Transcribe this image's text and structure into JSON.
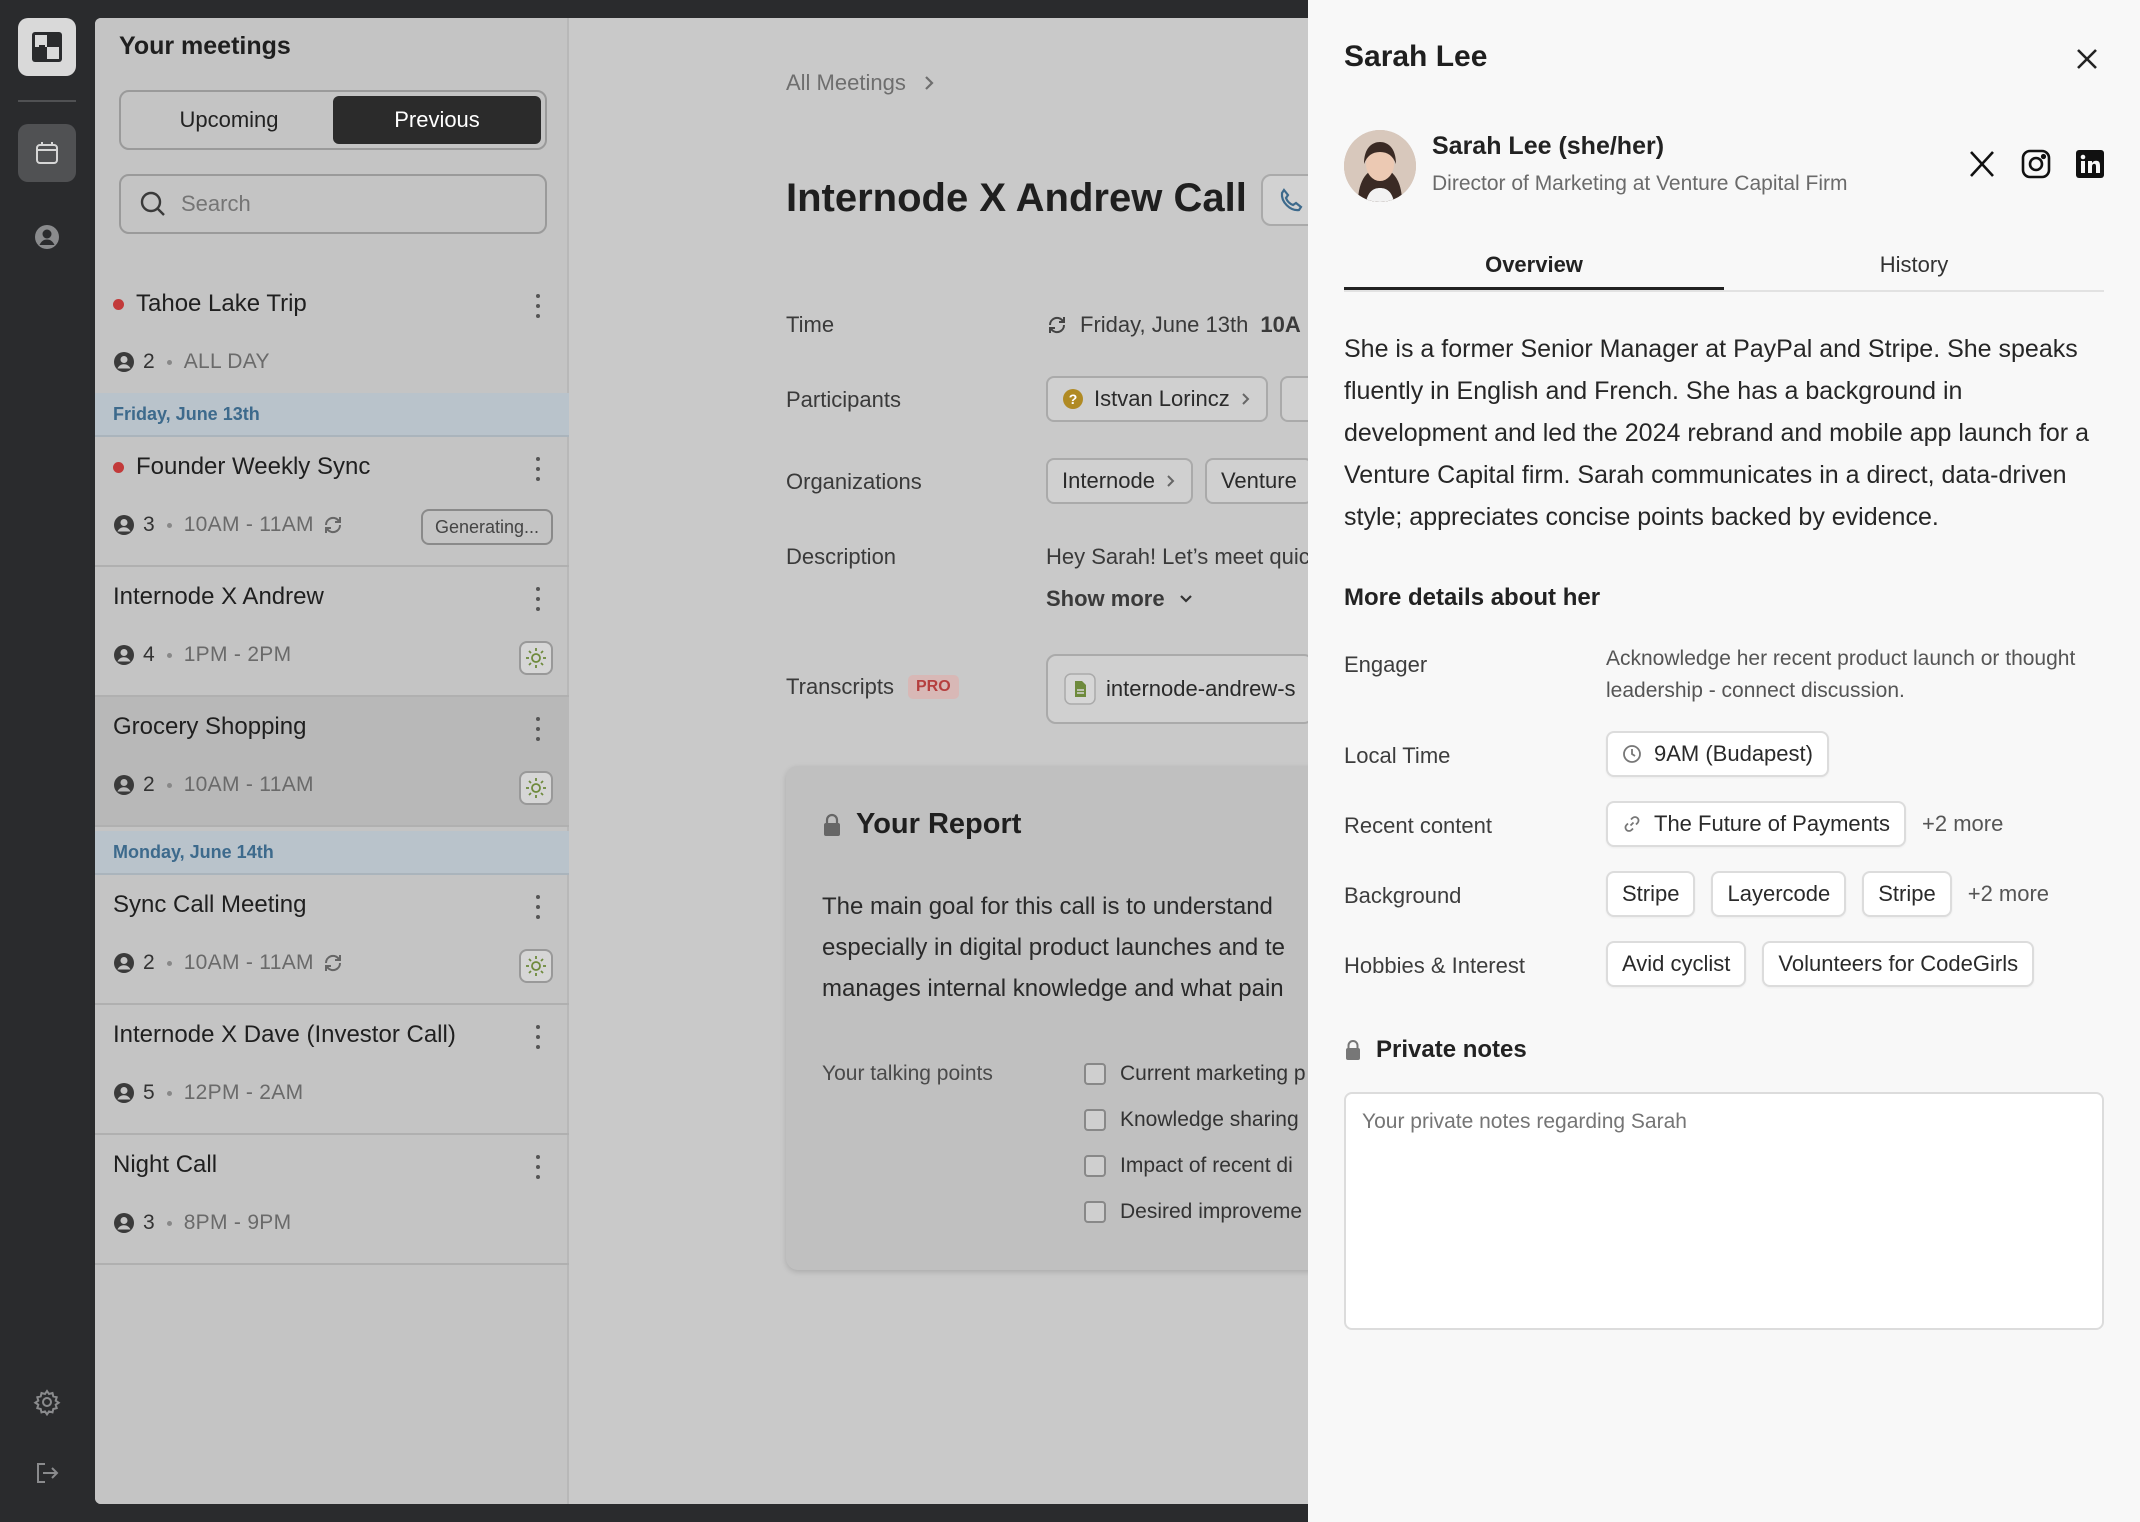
{
  "sidebar_title": "Your meetings",
  "segment": {
    "upcoming": "Upcoming",
    "previous": "Previous"
  },
  "search": {
    "placeholder": "Search"
  },
  "meetings": [
    {
      "title": "Tahoe Lake Trip",
      "count": "2",
      "time": "ALL DAY"
    },
    {
      "title": "Founder Weekly Sync",
      "count": "3",
      "time": "10AM - 11AM",
      "status": "Generating..."
    },
    {
      "title": "Internode X Andrew",
      "count": "4",
      "time": "1PM - 2PM"
    },
    {
      "title": "Grocery Shopping",
      "count": "2",
      "time": "10AM - 11AM"
    },
    {
      "title": "Sync Call Meeting",
      "count": "2",
      "time": "10AM - 11AM"
    },
    {
      "title": "Internode X Dave (Investor Call)",
      "count": "5",
      "time": "12PM - 2AM"
    },
    {
      "title": "Night Call",
      "count": "3",
      "time": "8PM - 9PM"
    }
  ],
  "day_headers": [
    "Friday, June 13th",
    "Monday, June 14th"
  ],
  "detail": {
    "breadcrumb": "All Meetings",
    "title": "Internode X Andrew Call",
    "time_label": "Time",
    "time_value": "Friday, June 13th",
    "time_bold": "10A",
    "participants_label": "Participants",
    "participant": "Istvan Lorincz",
    "organizations_label": "Organizations",
    "org1": "Internode",
    "org2": "Venture",
    "description_label": "Description",
    "description": "Hey Sarah! Let’s meet quic",
    "show_more": "Show more",
    "transcripts_label": "Transcripts",
    "pro_badge": "PRO",
    "transcript_file": "internode-andrew-s",
    "report_title": "Your Report",
    "report_lines": [
      "The main goal for this call is to understand",
      "especially in digital product launches and te",
      "manages internal knowledge and what pain"
    ],
    "talking_points_label": "Your talking points",
    "talking_points": [
      "Current marketing p",
      "Knowledge sharing",
      "Impact of recent di",
      "Desired improveme"
    ]
  },
  "drawer": {
    "name": "Sarah Lee",
    "person_name": "Sarah Lee (she/her)",
    "role": "Director of Marketing at Venture Capital Firm",
    "tabs": {
      "overview": "Overview",
      "history": "History"
    },
    "bio": "She is a former Senior Manager at PayPal and Stripe. She speaks fluently in English and French. She has a background in development and led the 2024 rebrand and mobile app launch for a Venture Capital firm. Sarah communicates in a direct, data-driven style; appreciates concise points backed by evidence.",
    "more_details_title": "More details about her",
    "engager_label": "Engager",
    "engager_value": "Acknowledge her recent product launch or thought leadership - connect discussion.",
    "local_time_label": "Local Time",
    "local_time_value": "9AM (Budapest)",
    "recent_content_label": "Recent content",
    "recent_content_value": "The Future of Payments",
    "recent_content_more": "+2 more",
    "background_label": "Background",
    "background": [
      "Stripe",
      "Layercode",
      "Stripe"
    ],
    "background_more": "+2 more",
    "hobbies_label": "Hobbies & Interest",
    "hobbies": [
      "Avid cyclist",
      "Volunteers for CodeGirls"
    ],
    "private_notes_title": "Private notes",
    "private_notes_placeholder": "Your private notes regarding Sarah"
  },
  "icons": {
    "rail": [
      "app-logo-icon",
      "calendar-icon",
      "user-icon",
      "settings-icon",
      "logout-icon"
    ],
    "social": [
      "x-icon",
      "instagram-icon",
      "linkedin-icon"
    ]
  }
}
